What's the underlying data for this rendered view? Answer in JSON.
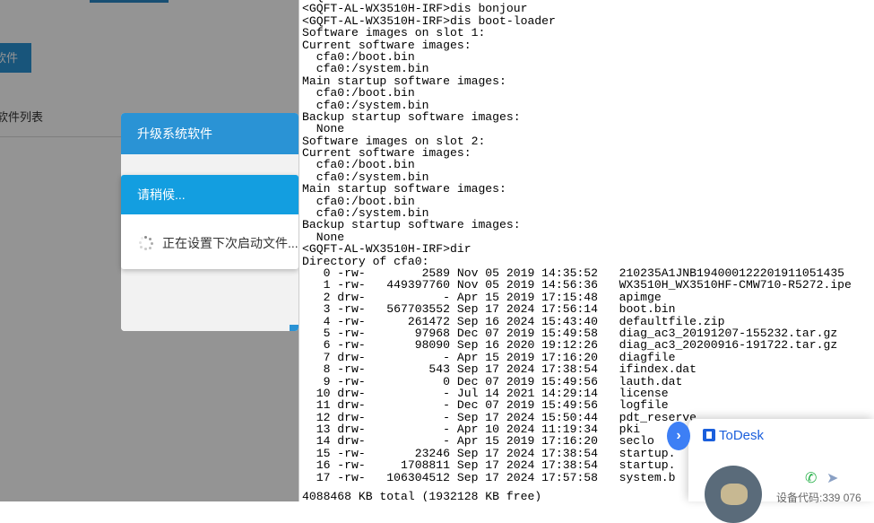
{
  "web": {
    "upload_label": "软件",
    "list_title": "软件列表",
    "dialog_title": "升级系统软件",
    "wait_title": "请稍候...",
    "wait_message": "正在设置下次启动文件..."
  },
  "terminal": {
    "lines": [
      "<GQFT-AL-WX3510H-IRF>dis bo",
      "<GQFT-AL-WX3510H-IRF>dis bonjour",
      "<GQFT-AL-WX3510H-IRF>dis boot-loader",
      "Software images on slot 1:",
      "Current software images:",
      "  cfa0:/boot.bin",
      "  cfa0:/system.bin",
      "Main startup software images:",
      "  cfa0:/boot.bin",
      "  cfa0:/system.bin",
      "Backup startup software images:",
      "  None",
      "Software images on slot 2:",
      "Current software images:",
      "  cfa0:/boot.bin",
      "  cfa0:/system.bin",
      "Main startup software images:",
      "  cfa0:/boot.bin",
      "  cfa0:/system.bin",
      "Backup startup software images:",
      "  None",
      "<GQFT-AL-WX3510H-IRF>dir",
      "Directory of cfa0:",
      "   0 -rw-        2589 Nov 05 2019 14:35:52   210235A1JNB194000122201911051435",
      "   1 -rw-   449397760 Nov 05 2019 14:56:36   WX3510H_WX3510HF-CMW710-R5272.ipe",
      "   2 drw-           - Apr 15 2019 17:15:48   apimge",
      "   3 -rw-   567703552 Sep 17 2024 17:56:14   boot.bin",
      "   4 -rw-      261472 Sep 16 2024 15:43:40   defaultfile.zip",
      "   5 -rw-       97968 Dec 07 2019 15:49:58   diag_ac3_20191207-155232.tar.gz",
      "   6 -rw-       98090 Sep 16 2020 19:12:26   diag_ac3_20200916-191722.tar.gz",
      "   7 drw-           - Apr 15 2019 17:16:20   diagfile",
      "   8 -rw-         543 Sep 17 2024 17:38:54   ifindex.dat",
      "   9 -rw-           0 Dec 07 2019 15:49:56   lauth.dat",
      "  10 drw-           - Jul 14 2021 14:29:14   license",
      "  11 drw-           - Dec 07 2019 15:49:56   logfile",
      "  12 drw-           - Sep 17 2024 15:50:44   pdt_reserve",
      "  13 drw-           - Apr 10 2024 11:19:34   pki",
      "  14 drw-           - Apr 15 2019 17:16:20   seclo",
      "  15 -rw-       23246 Sep 17 2024 17:38:54   startup.",
      "  16 -rw-     1708811 Sep 17 2024 17:38:54   startup.",
      "  17 -rw-   106304512 Sep 17 2024 17:57:58   system.b",
      ""
    ],
    "total": "4088468 KB total (1932128 KB free)"
  },
  "todesk": {
    "brand": "ToDesk",
    "device_code": "设备代码:339 076",
    "expand_glyph": "›",
    "phone_glyph": "✆",
    "cursor_glyph": "➤"
  }
}
